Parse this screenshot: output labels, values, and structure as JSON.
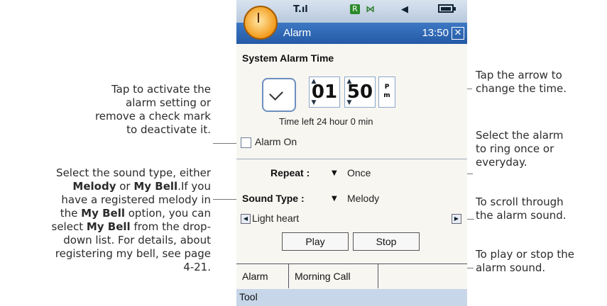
{
  "statusbar": {
    "signal": "T.ıl",
    "roaming_badge": "R",
    "bt": "⋈",
    "speaker": "◀",
    "battery": ""
  },
  "titlebar": {
    "title": "Alarm",
    "time": "13:50",
    "close": "✕"
  },
  "section_title": "System Alarm Time",
  "time": {
    "hours": "01",
    "minutes": "50",
    "ampm_top": "P",
    "ampm_bottom": "m"
  },
  "time_left": "Time left 24 hour 0 min",
  "alarm_on": {
    "label": "Alarm On",
    "checked": false
  },
  "repeat": {
    "label": "Repeat :",
    "value": "Once"
  },
  "sound_type": {
    "label": "Sound Type :",
    "value": "Melody"
  },
  "sound_name": "Light heart",
  "buttons": {
    "play": "Play",
    "stop": "Stop"
  },
  "tabs": [
    "Alarm",
    "Morning Call"
  ],
  "menu": {
    "tool": "Tool"
  },
  "annotations": {
    "alarm_on": [
      "Tap to activate the",
      "alarm setting or",
      "remove a check mark",
      "to deactivate it."
    ],
    "sound_type_1": "Select the sound type, either",
    "sound_type_2a": "Melody",
    "sound_type_2b": " or ",
    "sound_type_2c": "My Bell",
    "sound_type_2d": ".If you",
    "sound_type_3": "have a registered melody in",
    "sound_type_4a": "the ",
    "sound_type_4b": "My Bell",
    "sound_type_4c": " option, you can",
    "sound_type_5a": "select ",
    "sound_type_5b": "My Bell",
    "sound_type_5c": " from the drop-",
    "sound_type_6": "down list. For details, about",
    "sound_type_7": "registering my bell, see page",
    "sound_type_8": "4-21.",
    "arrow": [
      "Tap the arrow to",
      "change the time."
    ],
    "repeat": [
      "Select the alarm",
      "to ring once or",
      "everyday."
    ],
    "scroll": [
      "To scroll through",
      "the alarm sound."
    ],
    "playstop": [
      "To play or stop the",
      "alarm sound."
    ]
  }
}
